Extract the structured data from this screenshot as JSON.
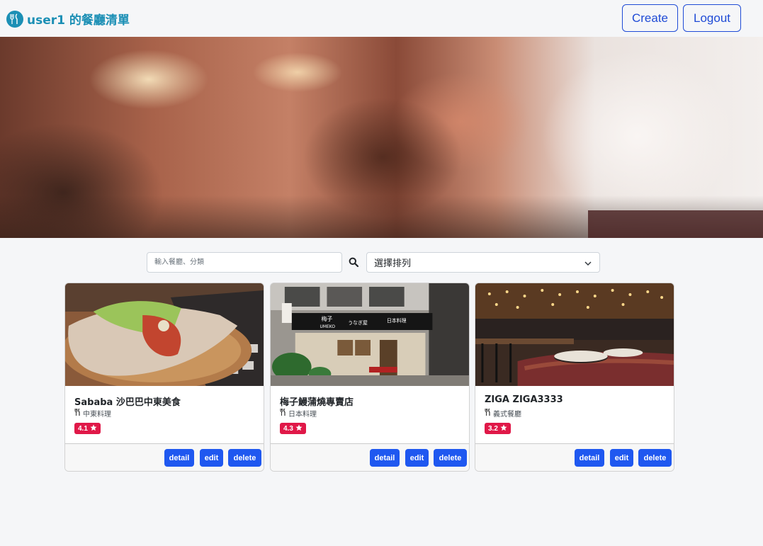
{
  "navbar": {
    "brand": "user1 的餐廳清單",
    "create_label": "Create",
    "logout_label": "Logout",
    "brand_color": "#1b8fb5",
    "button_color": "#1f4bd6"
  },
  "search": {
    "placeholder": "輸入餐廳、分類",
    "icon": "search-icon"
  },
  "sort": {
    "selected": "選擇排列"
  },
  "restaurants": [
    {
      "name": "Sababa 沙巴巴中東美食",
      "category": "中東料理",
      "rating": "4.1",
      "buttons": {
        "detail": "detail",
        "edit": "edit",
        "delete": "delete"
      }
    },
    {
      "name": "梅子鰻蒲燒專賣店",
      "category": "日本料理",
      "rating": "4.3",
      "buttons": {
        "detail": "detail",
        "edit": "edit",
        "delete": "delete"
      }
    },
    {
      "name": "ZIGA ZIGA3333",
      "category": "義式餐廳",
      "rating": "3.2",
      "buttons": {
        "detail": "detail",
        "edit": "edit",
        "delete": "delete"
      }
    }
  ],
  "photo_signs": {
    "umeko_jp": "梅子",
    "umeko_en": "UMEKO",
    "unagi": "うなぎ屋",
    "nihon": "日本料理"
  },
  "colors": {
    "rating_badge": "#e01848",
    "card_button": "#1f58f0"
  }
}
